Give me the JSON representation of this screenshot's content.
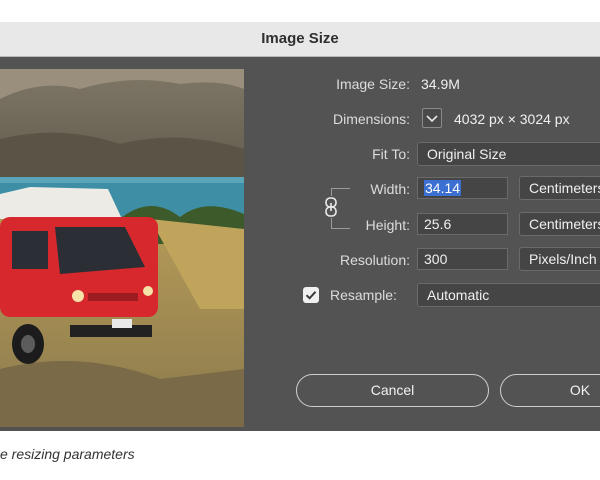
{
  "dialog": {
    "title": "Image Size",
    "image_size_label": "Image Size:",
    "image_size_value": "34.9M",
    "dimensions_label": "Dimensions:",
    "dimensions_value": "4032 px  ×  3024 px",
    "fit_to_label": "Fit To:",
    "fit_to_value": "Original Size",
    "width_label": "Width:",
    "width_value": "34.14",
    "width_unit": "Centimeters",
    "height_label": "Height:",
    "height_value": "25.6",
    "height_unit": "Centimeters",
    "resolution_label": "Resolution:",
    "resolution_value": "300",
    "resolution_unit": "Pixels/Inch",
    "resample_label": "Resample:",
    "resample_checked": true,
    "resample_value": "Automatic",
    "cancel_label": "Cancel",
    "ok_label": "OK"
  },
  "caption": "e resizing parameters",
  "colors": {
    "dialog_bg": "#535353",
    "titlebar_bg": "#e8e8e8",
    "selection": "#3b6fd1",
    "van_red": "#d7282d"
  }
}
